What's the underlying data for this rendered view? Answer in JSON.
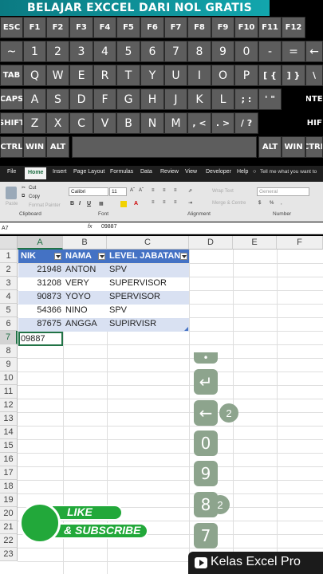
{
  "banner": {
    "title": "BELAJAR EXCCEL DARI NOL GRATIS"
  },
  "keyboard": {
    "row1": [
      "ESC",
      "F1",
      "F2",
      "F3",
      "F4",
      "F5",
      "F6",
      "F7",
      "F8",
      "F9",
      "F10",
      "F11",
      "F12"
    ],
    "row2": [
      "~",
      "1",
      "2",
      "3",
      "4",
      "5",
      "6",
      "7",
      "8",
      "9",
      "0",
      "-",
      "=",
      "←"
    ],
    "row3": [
      "TAB",
      "Q",
      "W",
      "E",
      "R",
      "T",
      "Y",
      "U",
      "I",
      "O",
      "P",
      "[ {",
      "] }",
      "\\"
    ],
    "row4": [
      "CAPS",
      "A",
      "S",
      "D",
      "F",
      "G",
      "H",
      "J",
      "K",
      "L",
      "; :",
      "' \"",
      "ENTER"
    ],
    "row5": [
      "SHIFT",
      "Z",
      "X",
      "C",
      "V",
      "B",
      "N",
      "M",
      ", <",
      ". >",
      "/ ?",
      "SHIFT"
    ],
    "row6": [
      "CTRL",
      "WIN",
      "ALT",
      "",
      "ALT",
      "WIN",
      "CTRL"
    ]
  },
  "ribbon": {
    "tabs": [
      "File",
      "Home",
      "Insert",
      "Page Layout",
      "Formulas",
      "Data",
      "Review",
      "View",
      "Developer",
      "Help"
    ],
    "tell_me": "Tell me what you want to",
    "cut": "Cut",
    "copy": "Copy",
    "format_painter": "Format Painter",
    "paste": "Paste",
    "font_name": "Calibri",
    "font_size": "11",
    "wrap_text": "Wrap Text",
    "merge_center": "Merge & Centre",
    "number_format": "General",
    "groups": [
      "Clipboard",
      "Font",
      "Alignment",
      "Number"
    ]
  },
  "formula_bar": {
    "name_box": "A7",
    "fx": "fx",
    "value": "09887"
  },
  "grid": {
    "columns": [
      "A",
      "B",
      "C",
      "D",
      "E",
      "F"
    ],
    "rows": [
      "1",
      "2",
      "3",
      "4",
      "5",
      "6",
      "7",
      "8",
      "9",
      "10",
      "11",
      "12",
      "13",
      "14",
      "15",
      "16",
      "17",
      "18",
      "19",
      "20",
      "21",
      "22",
      "23"
    ],
    "headers": [
      "NIK",
      "NAMA",
      "LEVEL JABATAN"
    ],
    "data": [
      [
        "21948",
        "ANTON",
        "SPV"
      ],
      [
        "31208",
        "VERY",
        "SUPERVISOR"
      ],
      [
        "90873",
        "YOYO",
        "SPERVISOR"
      ],
      [
        "54366",
        "NINO",
        "SPV"
      ],
      [
        "87675",
        "ANGGA",
        "SUPIRVISR"
      ]
    ],
    "active_value": "09887"
  },
  "key_overlays": [
    {
      "label": "↵",
      "count": ""
    },
    {
      "label": "←",
      "count": "2"
    },
    {
      "label": "0",
      "count": ""
    },
    {
      "label": "9",
      "count": ""
    },
    {
      "label": "8",
      "count": "2"
    },
    {
      "label": "7",
      "count": ""
    }
  ],
  "promo": {
    "like": "LIKE",
    "subscribe": "& SUBSCRIBE"
  },
  "brand": {
    "name": "Kelas Excel Pro"
  },
  "colors": {
    "banner": "#12a6ad",
    "excel_green": "#217346",
    "table_header": "#4472c4",
    "band": "#d9e1f2",
    "promo_green": "#22a83a"
  }
}
